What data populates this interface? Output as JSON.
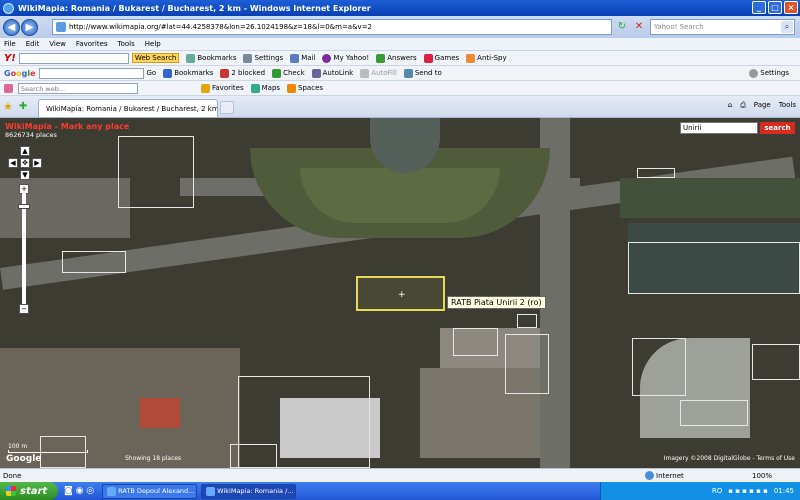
{
  "window": {
    "title": "WikiMapia: Romania / Bukarest / Bucharest, 2 km - Windows Internet Explorer"
  },
  "address": {
    "url": "http://www.wikimapia.org/#lat=44.4258378&lon=26.1024198&z=18&l=0&m=a&v=2",
    "search_placeholder": "Yahoo! Search"
  },
  "menu": [
    "File",
    "Edit",
    "View",
    "Favorites",
    "Tools",
    "Help"
  ],
  "yahoo_toolbar": {
    "logo": "Y!",
    "web_search": "Web Search",
    "items": [
      "Bookmarks",
      "Settings",
      "Mail",
      "My Yahoo!",
      "Answers",
      "Games",
      "Anti-Spy"
    ]
  },
  "google_toolbar": {
    "logo": "Google",
    "go": "Go",
    "items": [
      "Bookmarks",
      "2 blocked",
      "Check",
      "AutoLink",
      "AutoFill",
      "Send to"
    ],
    "settings": "Settings"
  },
  "third_toolbar": {
    "search_placeholder": "Search web...",
    "items": [
      "Favorites",
      "Maps",
      "Spaces"
    ]
  },
  "tab": {
    "label": "WikiMapia: Romania / Bukarest / Bucharest, 2 km"
  },
  "tab_tools": [
    "Page",
    "Tools"
  ],
  "map": {
    "header": "WikiMapia - Mark any place",
    "places": "8626734 places",
    "search_value": "Unirii",
    "search_btn": "search",
    "tooltip": "RATB Piata Unirii 2 (ro)",
    "scale_label": "100 m",
    "copyright": "Showing 18 places",
    "imagery": "Imagery ©2008 DigitalGlobe - Terms of Use"
  },
  "status": {
    "text": "Done",
    "zone": "Internet",
    "zoom": "100%"
  },
  "taskbar": {
    "start": "start",
    "tasks": [
      "RATB Depoul Alexand...",
      "WikiMapia: Romania /..."
    ],
    "lang": "RO",
    "time": "01:45"
  }
}
